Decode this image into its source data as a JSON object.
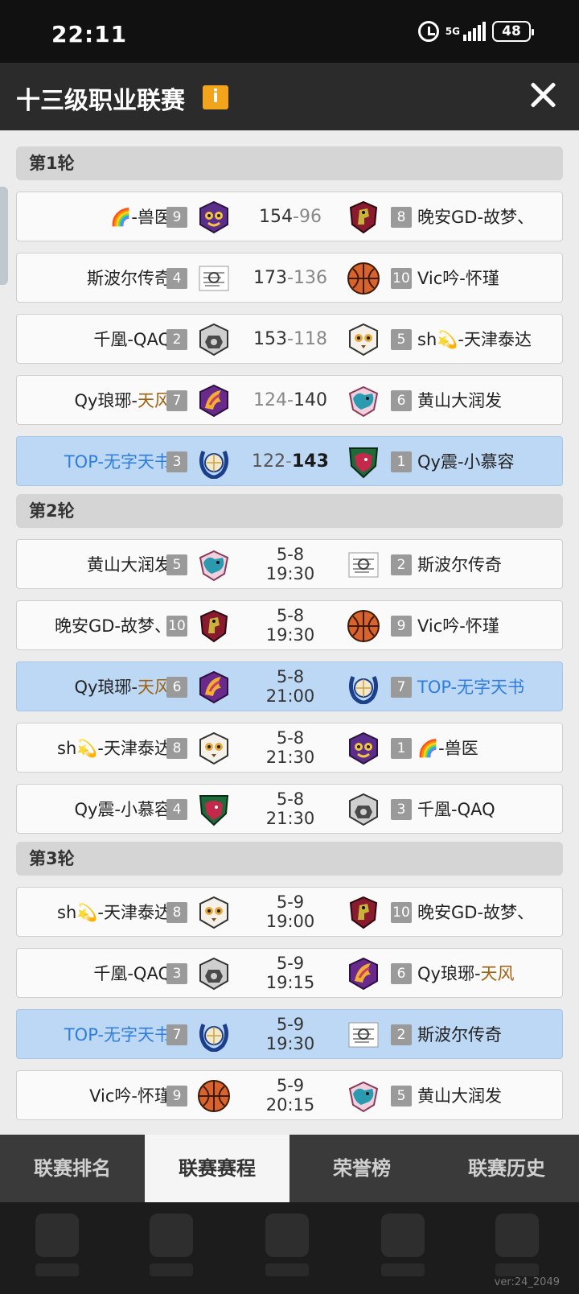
{
  "status": {
    "time": "22:11",
    "network": "5G",
    "battery": "48"
  },
  "header": {
    "title": "十三级职业联赛",
    "info_label": "i"
  },
  "rounds": [
    {
      "label": "第1轮"
    },
    {
      "label": "第2轮"
    },
    {
      "label": "第3轮"
    }
  ],
  "matches": [
    {
      "home": "🌈-兽医",
      "home_rank": "9",
      "away": "晚安GD-故梦、",
      "away_rank": "8",
      "score_home": "154",
      "score_away": "96",
      "home_logo": "owl-purple-logo",
      "away_logo": "dragon-shield-logo"
    },
    {
      "home": "斯波尔传奇",
      "home_rank": "4",
      "away": "Vic吟-怀瑾",
      "away_rank": "10",
      "score_home": "173",
      "score_away": "136",
      "home_logo": "sketch-logo",
      "away_logo": "basketball-orange-logo"
    },
    {
      "home": "千凰-QAQ",
      "home_rank": "2",
      "away": "sh💫-天津泰达",
      "away_rank": "5",
      "score_home": "153",
      "score_away": "118",
      "home_logo": "gray-hex-logo",
      "away_logo": "owl-white-logo"
    },
    {
      "home_a": "Qy琅琊-",
      "home_b": "天风",
      "home_rank": "7",
      "away": "黄山大润发",
      "away_rank": "6",
      "score_home": "124",
      "score_away": "140",
      "home_logo": "phoenix-purple-logo",
      "away_logo": "bull-teal-logo"
    },
    {
      "home": "TOP-无字天书",
      "home_rank": "3",
      "away": "Qy震-小慕容",
      "away_rank": "1",
      "score_home": "122",
      "score_away": "143",
      "home_logo": "laurel-ball-logo",
      "away_logo": "beast-shield-logo"
    },
    {
      "home": "黄山大润发",
      "home_rank": "5",
      "away": "斯波尔传奇",
      "away_rank": "2",
      "date": "5-8",
      "time": "19:30"
    },
    {
      "home": "晚安GD-故梦、",
      "home_rank": "10",
      "away": "Vic吟-怀瑾",
      "away_rank": "9",
      "date": "5-8",
      "time": "19:30"
    },
    {
      "home_a": "Qy琅琊-",
      "home_b": "天风",
      "home_rank": "6",
      "away": "TOP-无字天书",
      "away_rank": "7",
      "date": "5-8",
      "time": "21:00"
    },
    {
      "home": "sh💫-天津泰达",
      "home_rank": "8",
      "away": "🌈-兽医",
      "away_rank": "1",
      "date": "5-8",
      "time": "21:30"
    },
    {
      "home": "Qy震-小慕容",
      "home_rank": "4",
      "away": "千凰-QAQ",
      "away_rank": "3",
      "date": "5-8",
      "time": "21:30"
    },
    {
      "home": "sh💫-天津泰达",
      "home_rank": "8",
      "away": "晚安GD-故梦、",
      "away_rank": "10",
      "date": "5-9",
      "time": "19:00"
    },
    {
      "home": "千凰-QAQ",
      "home_rank": "3",
      "away_a": "Qy琅琊-",
      "away_b": "天风",
      "away_rank": "6",
      "date": "5-9",
      "time": "19:15"
    },
    {
      "home": "TOP-无字天书",
      "home_rank": "7",
      "away": "斯波尔传奇",
      "away_rank": "2",
      "date": "5-9",
      "time": "19:30"
    },
    {
      "home": "Vic吟-怀瑾",
      "home_rank": "9",
      "away": "黄山大润发",
      "away_rank": "5",
      "date": "5-9",
      "time": "20:15"
    }
  ],
  "tabs": [
    {
      "label": "联赛排名"
    },
    {
      "label": "联赛赛程"
    },
    {
      "label": "荣誉榜"
    },
    {
      "label": "联赛历史"
    }
  ],
  "version": "ver:24_2049",
  "colors": {
    "highlight_row": "#bcd8f4",
    "team_blue": "#2f7de1",
    "team_brown": "#a0620f",
    "info_badge": "#f2a51c"
  }
}
